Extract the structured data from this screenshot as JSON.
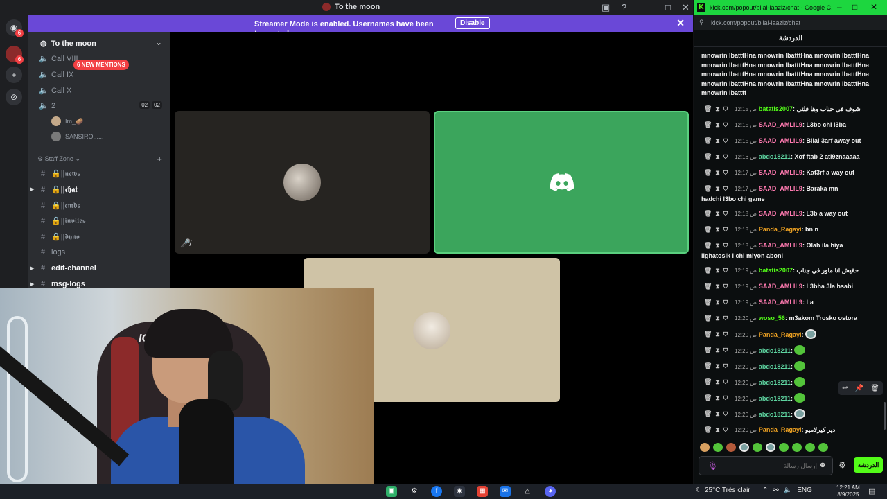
{
  "discord": {
    "window_title": "To the moon",
    "banner": {
      "message": "Streamer Mode is enabled. Usernames have been truncated.",
      "disable_label": "Disable"
    },
    "rail_badges": [
      "6",
      "6"
    ],
    "server_name": "To the moon",
    "mentions_pill": "6 NEW MENTIONS",
    "voice_channels": [
      "Call VIII",
      "Call IX",
      "Call X",
      "2"
    ],
    "vc_count": [
      "02",
      "02"
    ],
    "vc_users": [
      "Im_🥔",
      "SANSIRO......"
    ],
    "category": "Staff Zone",
    "text_channels": [
      "🔒||𝖓𝖊𝖜𝖘",
      "🔒||𝖈𝖍𝖆𝖙",
      "🔒||𝖈𝖒𝖉𝖘",
      "🔒||𝖎𝖓𝖛𝖎𝖙𝖊𝖘",
      "🔒||𝖉𝖞𝖓𝖔",
      "logs",
      "edit-channel",
      "msg-logs"
    ]
  },
  "chrome": {
    "title": "kick.com/popout/bilal-laaziz/chat - Google C...",
    "url": "kick.com/popout/bilal-laaziz/chat",
    "chat_header": "الدردشة",
    "spam": "mnowrin lbatttHna mnowrin lbatttHna mnowrin lbatttHna mnowrin lbatttHna mnowrin lbatttHna mnowrin lbatttHna mnowrin lbatttHna mnowrin lbatttHna mnowrin lbatttHna mnowrin lbatttHna mnowrin lbatttHna mnowrin lbatttHna mnowrin lbatttt",
    "messages": [
      {
        "time": "12:15 ص",
        "user": "batatis2007",
        "color": "#53fc18",
        "text": "شوف في جناب وها فلتي"
      },
      {
        "time": "12:15 ص",
        "user": "SAAD_AMLIL9",
        "color": "#ff7ab0",
        "text": "L3bo chi l3ba"
      },
      {
        "time": "12:15 ص",
        "user": "SAAD_AMLIL9",
        "color": "#ff7ab0",
        "text": "Bilal 3arf away out"
      },
      {
        "time": "12:16 ص",
        "user": "abdo18211",
        "color": "#5ed4a0",
        "text": "Xof ftab 2 atl9znaaaaa"
      },
      {
        "time": "12:17 ص",
        "user": "SAAD_AMLIL9",
        "color": "#ff7ab0",
        "text": "Kat3rf a way out"
      },
      {
        "time": "12:17 ص",
        "user": "SAAD_AMLIL9",
        "color": "#ff7ab0",
        "text": "Baraka mn hadchi l3bo chi game"
      },
      {
        "time": "12:18 ص",
        "user": "SAAD_AMLIL9",
        "color": "#ff7ab0",
        "text": "L3b a way out"
      },
      {
        "time": "12:18 ص",
        "user": "Panda_Ragayi",
        "color": "#f5a623",
        "text": "bn n"
      },
      {
        "time": "12:18 ص",
        "user": "SAAD_AMLIL9",
        "color": "#ff7ab0",
        "text": "Olah ila hiya lighatosik l chi mlyon aboni"
      },
      {
        "time": "12:19 ص",
        "user": "batatis2007",
        "color": "#53fc18",
        "text": "حقيش انا ماور في جناب"
      },
      {
        "time": "12:19 ص",
        "user": "SAAD_AMLIL9",
        "color": "#ff7ab0",
        "text": "L3bha 3la hsabi"
      },
      {
        "time": "12:19 ص",
        "user": "SAAD_AMLIL9",
        "color": "#ff7ab0",
        "text": "La"
      },
      {
        "time": "12:20 ص",
        "user": "woso_56",
        "color": "#53fc18",
        "text": "m3akom Trosko ostora"
      },
      {
        "time": "12:20 ص",
        "user": "Panda_Ragayi",
        "color": "#f5a623",
        "emote": "eyes-emote"
      },
      {
        "time": "12:20 ص",
        "user": "abdo18211",
        "color": "#5ed4a0",
        "emote": "frog-emote"
      },
      {
        "time": "12:20 ص",
        "user": "abdo18211",
        "color": "#5ed4a0",
        "emote": "frog-emote"
      },
      {
        "time": "12:20 ص",
        "user": "abdo18211",
        "color": "#5ed4a0",
        "emote": "frog-emote"
      },
      {
        "time": "12:20 ص",
        "user": "abdo18211",
        "color": "#5ed4a0",
        "emote": "frog-emote"
      },
      {
        "time": "12:20 ص",
        "user": "abdo18211",
        "color": "#5ed4a0",
        "emote": "eyes-emote"
      },
      {
        "time": "12:20 ص",
        "user": "Panda_Ragayi",
        "color": "#f5a623",
        "text": "دير كيرلاميو"
      }
    ],
    "input_placeholder": "إرسال رسالة",
    "send_label": "الدردشة"
  },
  "taskbar": {
    "weather": "25°C  Très clair",
    "language": "ENG",
    "time": "12:21 AM",
    "date": "8/9/2025"
  },
  "colors": {
    "banner": "#6a48d7",
    "kick_green": "#53fc18",
    "speaking_tile": "#3ba55c"
  }
}
